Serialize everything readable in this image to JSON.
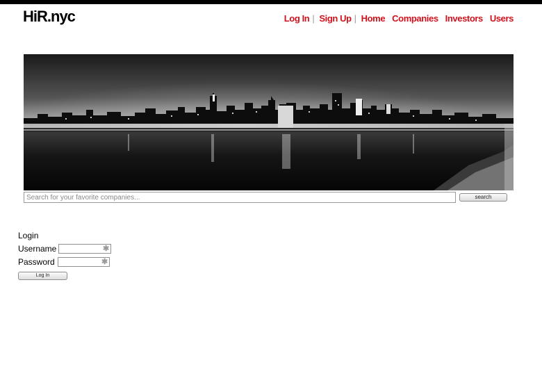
{
  "brand": {
    "logo": "HiR.nyc"
  },
  "nav": {
    "login": "Log In",
    "signup": "Sign Up",
    "home": "Home",
    "companies": "Companies",
    "investors": "Investors",
    "users": "Users",
    "accent_color": "#d0121c"
  },
  "hero": {
    "image": "nyc-skyline-night-panorama"
  },
  "search": {
    "placeholder": "Search for your favorite companies...",
    "value": "",
    "button_label": "search"
  },
  "login": {
    "title": "Login",
    "username_label": "Username",
    "username_value": "",
    "password_label": "Password",
    "password_value": "",
    "required_marker": "✱",
    "button_label": "Log In"
  }
}
